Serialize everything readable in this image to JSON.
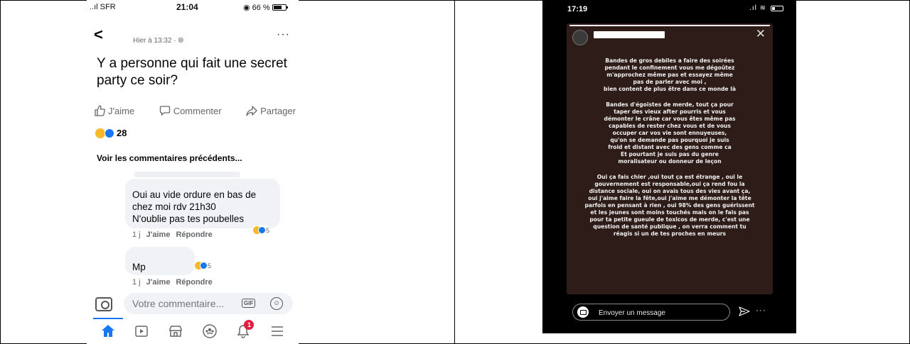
{
  "facebook": {
    "status_bar": {
      "carrier": "..ıl SFR",
      "time": "21:04",
      "battery": "66 %"
    },
    "header": {
      "timestamp": "Hier à 13:32 · ",
      "more": "···"
    },
    "post": {
      "text": "Y a personne qui fait une secret party ce soir?"
    },
    "actions": {
      "like": "J'aime",
      "comment": "Commenter",
      "share": "Partager"
    },
    "reactions": {
      "count": "28"
    },
    "previous_comments": "Voir les commentaires précédents...",
    "comments": [
      {
        "lines": [
          "Oui au vide ordure en bas de",
          "chez moi rdv 21h30",
          "N'oublie pas tes poubelles"
        ],
        "time": "1 j",
        "like": "J'aime",
        "reply": "Répondre",
        "reaction_count": "5"
      },
      {
        "lines": [
          "Mp"
        ],
        "time": "1 j",
        "like": "J'aime",
        "reply": "Répondre",
        "reaction_count": "5"
      }
    ],
    "composer": {
      "placeholder": "Votre commentaire...",
      "gif": "GIF"
    },
    "tabbar": {
      "notification_badge": "1"
    },
    "colors": {
      "accent": "#1877f2",
      "badge": "#e41e3f",
      "haha": "#f7b928"
    }
  },
  "instagram": {
    "status_bar": {
      "time": "17:19"
    },
    "story": {
      "paragraphs": [
        [
          "Bandes de gros debiles a faire des soirées",
          "pendant le confinement vous me dégoûtez",
          "m'approchez même pas et essayez même",
          "pas de parler avec moi ,",
          "bien content de plus être dans ce monde là"
        ],
        [
          "Bandes d'égoïstes de merde, tout ça pour",
          "taper des vieux after pourris et vous",
          "démonter le crâne car vous êtes même pas",
          "capables de rester chez vous et de vous",
          "occuper car vos vie sont ennuyeuses,",
          "qu'on se demande pas pourquoi je suis",
          "froid et distant avec des gens comme ca",
          "Et pourtant je suis pas du genre",
          "moralisateur ou donneur de leçon"
        ],
        [
          "Oui ça fais chier ,oui tout ça est étrange , oui le",
          "gouvernement est responsable,oui ça rend fou la",
          "distance sociale, oui on avais tous des vies avant ça,",
          "oui j'aime faire la fête,oui j'aime me démonter la tête",
          "parfois en pensant à rien , oui 98% des gens guérissent",
          "et les jeunes sont moins touchés mais on le fais pas",
          "pour ta petite gueule de toxicos de merde, c'est une",
          "question de santé publique , on verra comment tu",
          "réagis si un de tes proches en meurs"
        ]
      ]
    },
    "message": {
      "placeholder": "Envoyer un message",
      "more": "···"
    },
    "colors": {
      "story_bg": "#2d1c18"
    }
  }
}
